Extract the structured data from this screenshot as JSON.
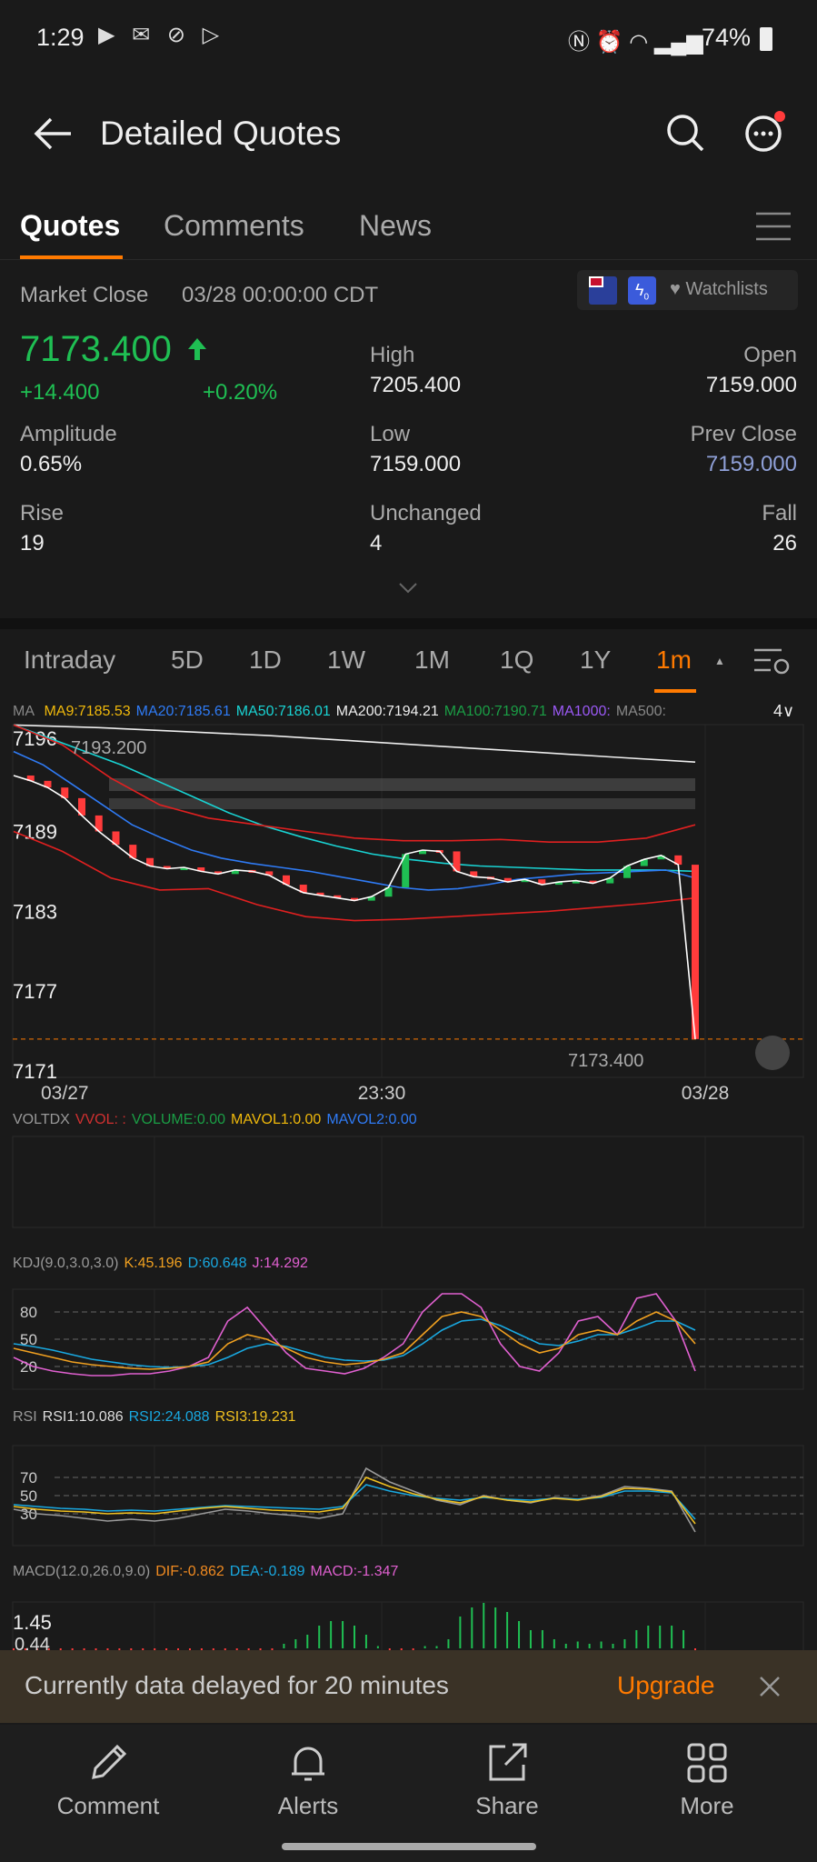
{
  "status_bar": {
    "time": "1:29",
    "battery": "74%"
  },
  "header": {
    "title": "Detailed Quotes"
  },
  "tabs": [
    {
      "label": "Quotes",
      "active": true
    },
    {
      "label": "Comments"
    },
    {
      "label": "News"
    }
  ],
  "market": {
    "status": "Market Close",
    "datetime": "03/28 00:00:00 CDT",
    "watchlists": "Watchlists",
    "badge": "0"
  },
  "quote": {
    "price": "7173.400",
    "change": "+14.400",
    "change_pct": "+0.20%",
    "high_label": "High",
    "high": "7205.400",
    "open_label": "Open",
    "open": "7159.000",
    "amplitude_label": "Amplitude",
    "amplitude": "0.65%",
    "low_label": "Low",
    "low": "7159.000",
    "prev_close_label": "Prev Close",
    "prev_close": "7159.000",
    "rise_label": "Rise",
    "rise": "19",
    "unchanged_label": "Unchanged",
    "unchanged": "4",
    "fall_label": "Fall",
    "fall": "26"
  },
  "periods": [
    {
      "label": "Intraday"
    },
    {
      "label": "5D"
    },
    {
      "label": "1D"
    },
    {
      "label": "1W"
    },
    {
      "label": "1M"
    },
    {
      "label": "1Q"
    },
    {
      "label": "1Y"
    },
    {
      "label": "1m",
      "active": true
    }
  ],
  "colors": {
    "up": "#1fbf53",
    "down": "#ff3b3b",
    "accent": "#ff7a00"
  },
  "ma_legend": {
    "title": "MA",
    "items": [
      {
        "t": "MA9:7185.53",
        "c": "#f0b90b"
      },
      {
        "t": "MA20:7185.61",
        "c": "#2f7bf5"
      },
      {
        "t": "MA50:7186.01",
        "c": "#19d3d3"
      },
      {
        "t": "MA200:7194.21",
        "c": "#eeeeee"
      },
      {
        "t": "MA100:7190.71",
        "c": "#1a9e45"
      },
      {
        "t": "MA1000:",
        "c": "#9b59f5"
      },
      {
        "t": "MA500:",
        "c": "#888888"
      }
    ],
    "count": "4"
  },
  "vol_legend": {
    "title": "VOLTDX",
    "items": [
      {
        "t": "VVOL: :",
        "c": "#d03030"
      },
      {
        "t": "VOLUME:0.00",
        "c": "#1a9e45"
      },
      {
        "t": "MAVOL1:0.00",
        "c": "#f0b90b"
      },
      {
        "t": "MAVOL2:0.00",
        "c": "#2f7bf5"
      }
    ]
  },
  "kdj_legend": {
    "title": "KDJ(9.0,3.0,3.0)",
    "items": [
      {
        "t": "K:45.196",
        "c": "#f0a020"
      },
      {
        "t": "D:60.648",
        "c": "#19a8e0"
      },
      {
        "t": "J:14.292",
        "c": "#e060d0"
      }
    ]
  },
  "rsi_legend": {
    "title": "RSI",
    "items": [
      {
        "t": "RSI1:10.086",
        "c": "#dddddd"
      },
      {
        "t": "RSI2:24.088",
        "c": "#19a8e0"
      },
      {
        "t": "RSI3:19.231",
        "c": "#f0c020"
      }
    ]
  },
  "macd_legend": {
    "title": "MACD(12.0,26.0,9.0)",
    "items": [
      {
        "t": "DIF:-0.862",
        "c": "#f08a20"
      },
      {
        "t": "DEA:-0.189",
        "c": "#19a8e0"
      },
      {
        "t": "MACD:-1.347",
        "c": "#e060d0"
      }
    ]
  },
  "chart_data": {
    "type": "line",
    "main": {
      "yticks": [
        "7196",
        "7189",
        "7183",
        "7177",
        "7171"
      ],
      "ylim": [
        7171,
        7196
      ],
      "xticks": [
        "03/27",
        "23:30",
        "03/28"
      ],
      "high_marker": "7193.200",
      "last_marker": "7173.400",
      "close": [
        7193.2,
        7192.8,
        7192.3,
        7191.5,
        7190.2,
        7189,
        7188,
        7187,
        7186.4,
        7186.2,
        7186.3,
        7186,
        7185.8,
        7186.1,
        7186,
        7185.7,
        7185,
        7184.4,
        7184.2,
        7184,
        7183.8,
        7184.1,
        7184.8,
        7187.3,
        7187.6,
        7187.5,
        7186,
        7185.6,
        7185.5,
        7185.2,
        7185.4,
        7185,
        7185.2,
        7185.3,
        7185.1,
        7185.5,
        7186.4,
        7186.9,
        7187.2,
        7186.5,
        7173.4
      ],
      "ma20": [
        7195,
        7194,
        7192.5,
        7191,
        7189.5,
        7188.5,
        7187.6,
        7187,
        7186.6,
        7186.3,
        7186,
        7185.6,
        7185.2,
        7184.8,
        7184.6,
        7184.7,
        7185,
        7185.4,
        7185.6,
        7185.8,
        7185.9,
        7186,
        7186.1,
        7185.5
      ],
      "ma50": [
        7197,
        7196,
        7195,
        7194,
        7192.8,
        7191.6,
        7190.4,
        7189.4,
        7188.6,
        7187.9,
        7187.3,
        7186.9,
        7186.6,
        7186.4,
        7186.3,
        7186.2,
        7186.1,
        7186.1,
        7186.1,
        7186
      ],
      "ma200": [
        7197,
        7196.8,
        7196.5,
        7196.2,
        7195.8,
        7195.4,
        7195,
        7194.6,
        7194.21
      ],
      "boll_up": [
        7197,
        7195.5,
        7193,
        7191,
        7190,
        7189.5,
        7189,
        7188.5,
        7188.3,
        7188.3,
        7188.4,
        7188.2,
        7188.2,
        7188.5,
        7189.5
      ],
      "boll_low": [
        7189,
        7187.5,
        7185.5,
        7184.6,
        7184.7,
        7183.5,
        7182.6,
        7182.3,
        7182.4,
        7182.6,
        7182.8,
        7183,
        7183.3,
        7183.6,
        7184
      ]
    },
    "kdj": {
      "yticks": [
        "80",
        "50",
        "20"
      ],
      "ylim": [
        0,
        100
      ],
      "K": [
        40,
        35,
        30,
        25,
        22,
        20,
        18,
        17,
        18,
        20,
        25,
        45,
        55,
        50,
        40,
        30,
        25,
        22,
        24,
        28,
        35,
        55,
        75,
        80,
        75,
        60,
        45,
        35,
        40,
        55,
        60,
        55,
        70,
        80,
        70,
        45
      ],
      "D": [
        45,
        42,
        38,
        33,
        28,
        25,
        22,
        20,
        19,
        20,
        22,
        30,
        40,
        45,
        42,
        36,
        30,
        27,
        26,
        27,
        32,
        45,
        60,
        70,
        72,
        65,
        55,
        45,
        43,
        48,
        55,
        55,
        62,
        70,
        70,
        60
      ],
      "J": [
        30,
        20,
        15,
        12,
        10,
        10,
        12,
        12,
        15,
        20,
        30,
        70,
        85,
        60,
        35,
        18,
        15,
        12,
        18,
        30,
        45,
        80,
        100,
        100,
        85,
        45,
        20,
        15,
        35,
        70,
        75,
        55,
        95,
        100,
        70,
        15
      ]
    },
    "rsi": {
      "yticks": [
        "70",
        "50",
        "30"
      ],
      "ylim": [
        0,
        100
      ],
      "RSI1": [
        35,
        30,
        28,
        25,
        22,
        24,
        22,
        25,
        30,
        35,
        33,
        30,
        28,
        25,
        30,
        80,
        65,
        55,
        45,
        40,
        50,
        45,
        42,
        48,
        46,
        50,
        60,
        58,
        55,
        10
      ],
      "RSI2": [
        40,
        38,
        36,
        35,
        33,
        34,
        33,
        35,
        37,
        39,
        38,
        37,
        36,
        35,
        38,
        62,
        55,
        50,
        47,
        45,
        48,
        46,
        45,
        47,
        46,
        48,
        55,
        55,
        53,
        24
      ],
      "RSI3": [
        38,
        35,
        33,
        32,
        30,
        31,
        30,
        33,
        36,
        38,
        36,
        34,
        33,
        32,
        36,
        70,
        60,
        52,
        46,
        42,
        49,
        45,
        43,
        47,
        45,
        49,
        58,
        57,
        54,
        19
      ]
    },
    "macd": {
      "yticks": [
        "1.45",
        "0.44"
      ],
      "hist": [
        -0.5,
        -0.5,
        -0.5,
        -0.5,
        -0.5,
        -0.5,
        -0.5,
        -0.5,
        -0.5,
        -0.5,
        -0.5,
        -0.5,
        -0.5,
        -0.5,
        -0.5,
        -0.5,
        -0.5,
        -0.5,
        -0.5,
        -0.5,
        -0.3,
        -0.2,
        -0.1,
        0.1,
        0.2,
        0.3,
        0.5,
        0.6,
        0.6,
        0.5,
        0.3,
        0.05,
        -0.05,
        -0.05,
        -0.05,
        0.05,
        0.05,
        0.2,
        0.7,
        0.9,
        1.0,
        0.9,
        0.8,
        0.6,
        0.4,
        0.4,
        0.2,
        0.1,
        0.15,
        0.1,
        0.15,
        0.1,
        0.2,
        0.4,
        0.5,
        0.5,
        0.5,
        0.4,
        -0.5
      ]
    }
  },
  "delay_banner": {
    "text": "Currently data delayed for 20 minutes",
    "upgrade": "Upgrade"
  },
  "bottom_nav": [
    {
      "label": "Comment"
    },
    {
      "label": "Alerts"
    },
    {
      "label": "Share"
    },
    {
      "label": "More"
    }
  ]
}
